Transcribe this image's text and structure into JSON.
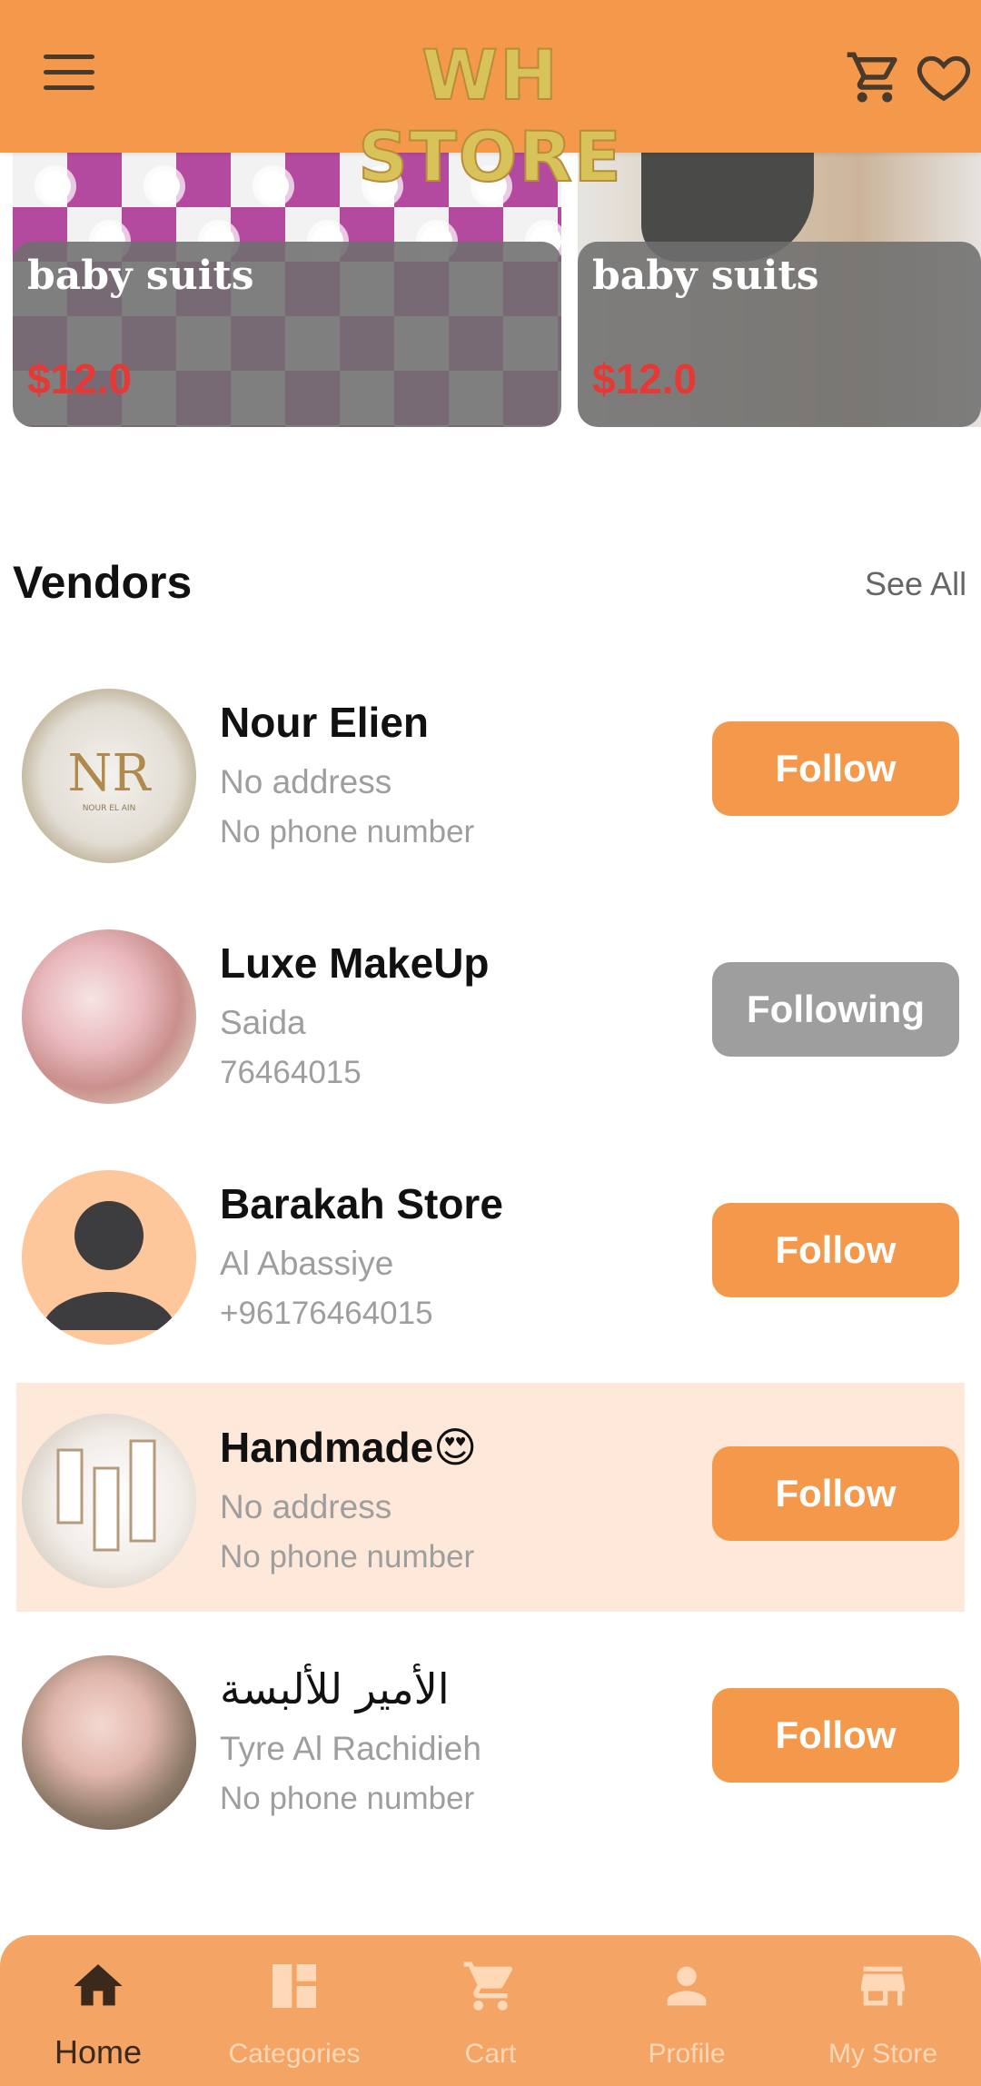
{
  "header": {
    "logo_text": "WH STORE",
    "menu_icon": "hamburger-menu-icon",
    "cart_icon": "cart-icon",
    "wishlist_icon": "heart-icon"
  },
  "products": [
    {
      "name": "baby suits",
      "price": "$12.0"
    },
    {
      "name": "baby suits",
      "price": "$12.0"
    }
  ],
  "vendors_section": {
    "title": "Vendors",
    "see_all": "See All"
  },
  "vendors": [
    {
      "name": "Nour Elien",
      "address": "No address",
      "phone": "No phone number",
      "button": "Follow"
    },
    {
      "name": "Luxe MakeUp",
      "address": "Saida",
      "phone": "76464015",
      "button": "Following"
    },
    {
      "name": "Barakah Store",
      "address": "Al Abassiye",
      "phone": "+96176464015",
      "button": "Follow"
    },
    {
      "name": "Handmade😍",
      "address": "No address",
      "phone": "No phone number",
      "button": "Follow"
    },
    {
      "name": "الأمير للألبسة",
      "address": "Tyre Al Rachidieh",
      "phone": "No phone number",
      "button": "Follow"
    }
  ],
  "bottom_nav": [
    {
      "label": "Home",
      "icon": "home-icon",
      "active": true
    },
    {
      "label": "Categories",
      "icon": "categories-icon",
      "active": false
    },
    {
      "label": "Cart",
      "icon": "cart-icon",
      "active": false
    },
    {
      "label": "Profile",
      "icon": "profile-icon",
      "active": false
    },
    {
      "label": "My Store",
      "icon": "store-icon",
      "active": false
    }
  ],
  "colors": {
    "primary": "#f4994c",
    "price": "#e53935",
    "following": "#9e9e9e",
    "highlight": "#fde8d9"
  }
}
